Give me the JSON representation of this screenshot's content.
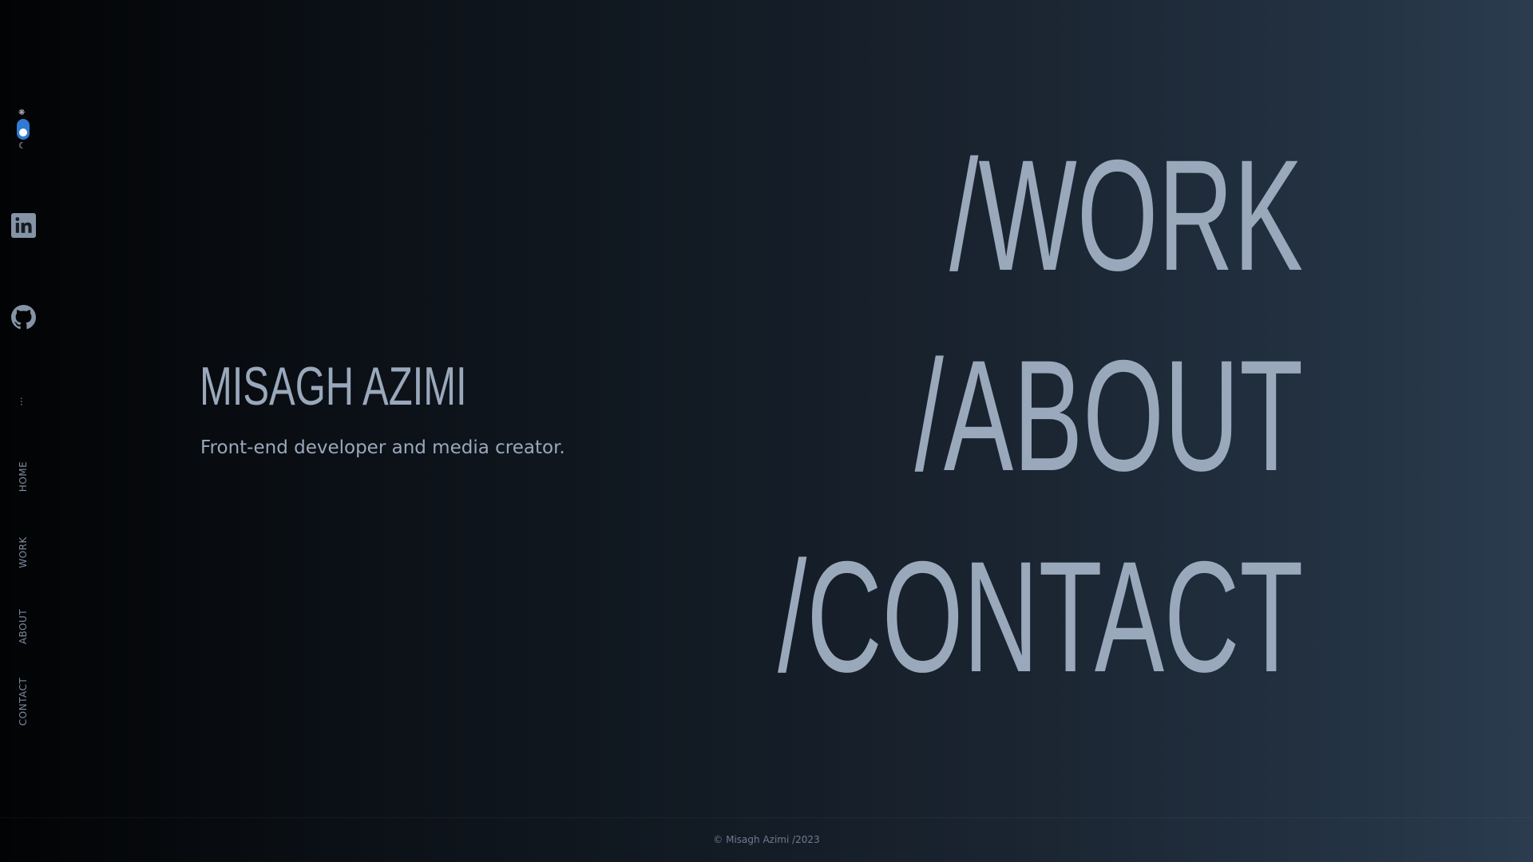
{
  "theme_toggle": {
    "sun_icon": "sun-icon",
    "moon_icon": "moon-icon",
    "track_color": "#2f7ad3",
    "active_mode": "dark"
  },
  "social": {
    "linkedin_icon": "linkedin-icon",
    "github_icon": "github-icon"
  },
  "sidebar": {
    "ellipsis": "...",
    "nav_items": [
      "HOME",
      "WORK",
      "ABOUT",
      "CONTACT"
    ]
  },
  "hero": {
    "name": "MISAGH AZIMI",
    "tagline": "Front-end developer and media creator."
  },
  "big_nav": {
    "links": [
      "/WORK",
      "/ABOUT",
      "/CONTACT"
    ]
  },
  "footer": {
    "copyright": "© Misagh Azimi /2023"
  },
  "colors": {
    "text": "#9aa8bb",
    "muted": "#7c8a9d",
    "accent": "#2f7ad3"
  }
}
